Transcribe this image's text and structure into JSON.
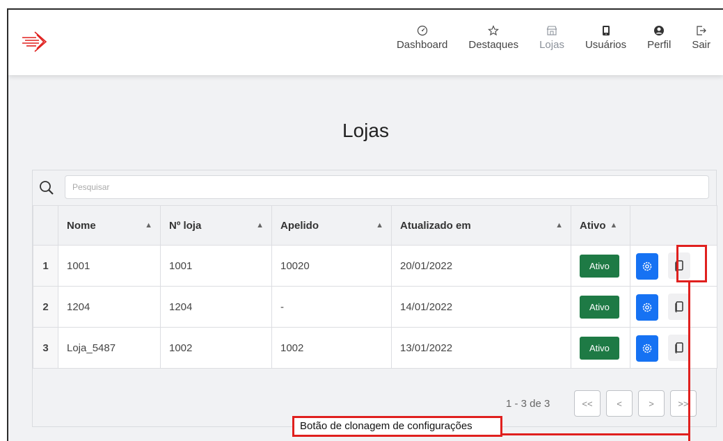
{
  "nav": {
    "items": [
      {
        "label": "Dashboard",
        "icon": "gauge-icon"
      },
      {
        "label": "Destaques",
        "icon": "star-icon"
      },
      {
        "label": "Lojas",
        "icon": "store-icon"
      },
      {
        "label": "Usuários",
        "icon": "phone-icon"
      },
      {
        "label": "Perfil",
        "icon": "user-circle-icon"
      },
      {
        "label": "Sair",
        "icon": "logout-icon"
      }
    ],
    "active": "Lojas"
  },
  "page": {
    "title": "Lojas"
  },
  "search": {
    "placeholder": "Pesquisar",
    "value": ""
  },
  "table": {
    "columns": [
      "Nome",
      "Nº loja",
      "Apelido",
      "Atualizado em",
      "Ativo"
    ],
    "rows": [
      {
        "index": "1",
        "nome": "1001",
        "numero": "1001",
        "apelido": "10020",
        "atualizado": "20/01/2022",
        "ativo": "Ativo"
      },
      {
        "index": "2",
        "nome": "1204",
        "numero": "1204",
        "apelido": "-",
        "atualizado": "14/01/2022",
        "ativo": "Ativo"
      },
      {
        "index": "3",
        "nome": "Loja_5487",
        "numero": "1002",
        "apelido": "1002",
        "atualizado": "13/01/2022",
        "ativo": "Ativo"
      }
    ]
  },
  "pagination": {
    "info": "1 - 3 de 3",
    "first": "<<",
    "prev": "<",
    "next": ">",
    "last": ">>"
  },
  "annotation": {
    "text": "Botão de clonagem de configurações"
  },
  "colors": {
    "accent_red": "#e0201e",
    "ativo_green": "#1e7a45",
    "gear_blue": "#1672f3"
  }
}
